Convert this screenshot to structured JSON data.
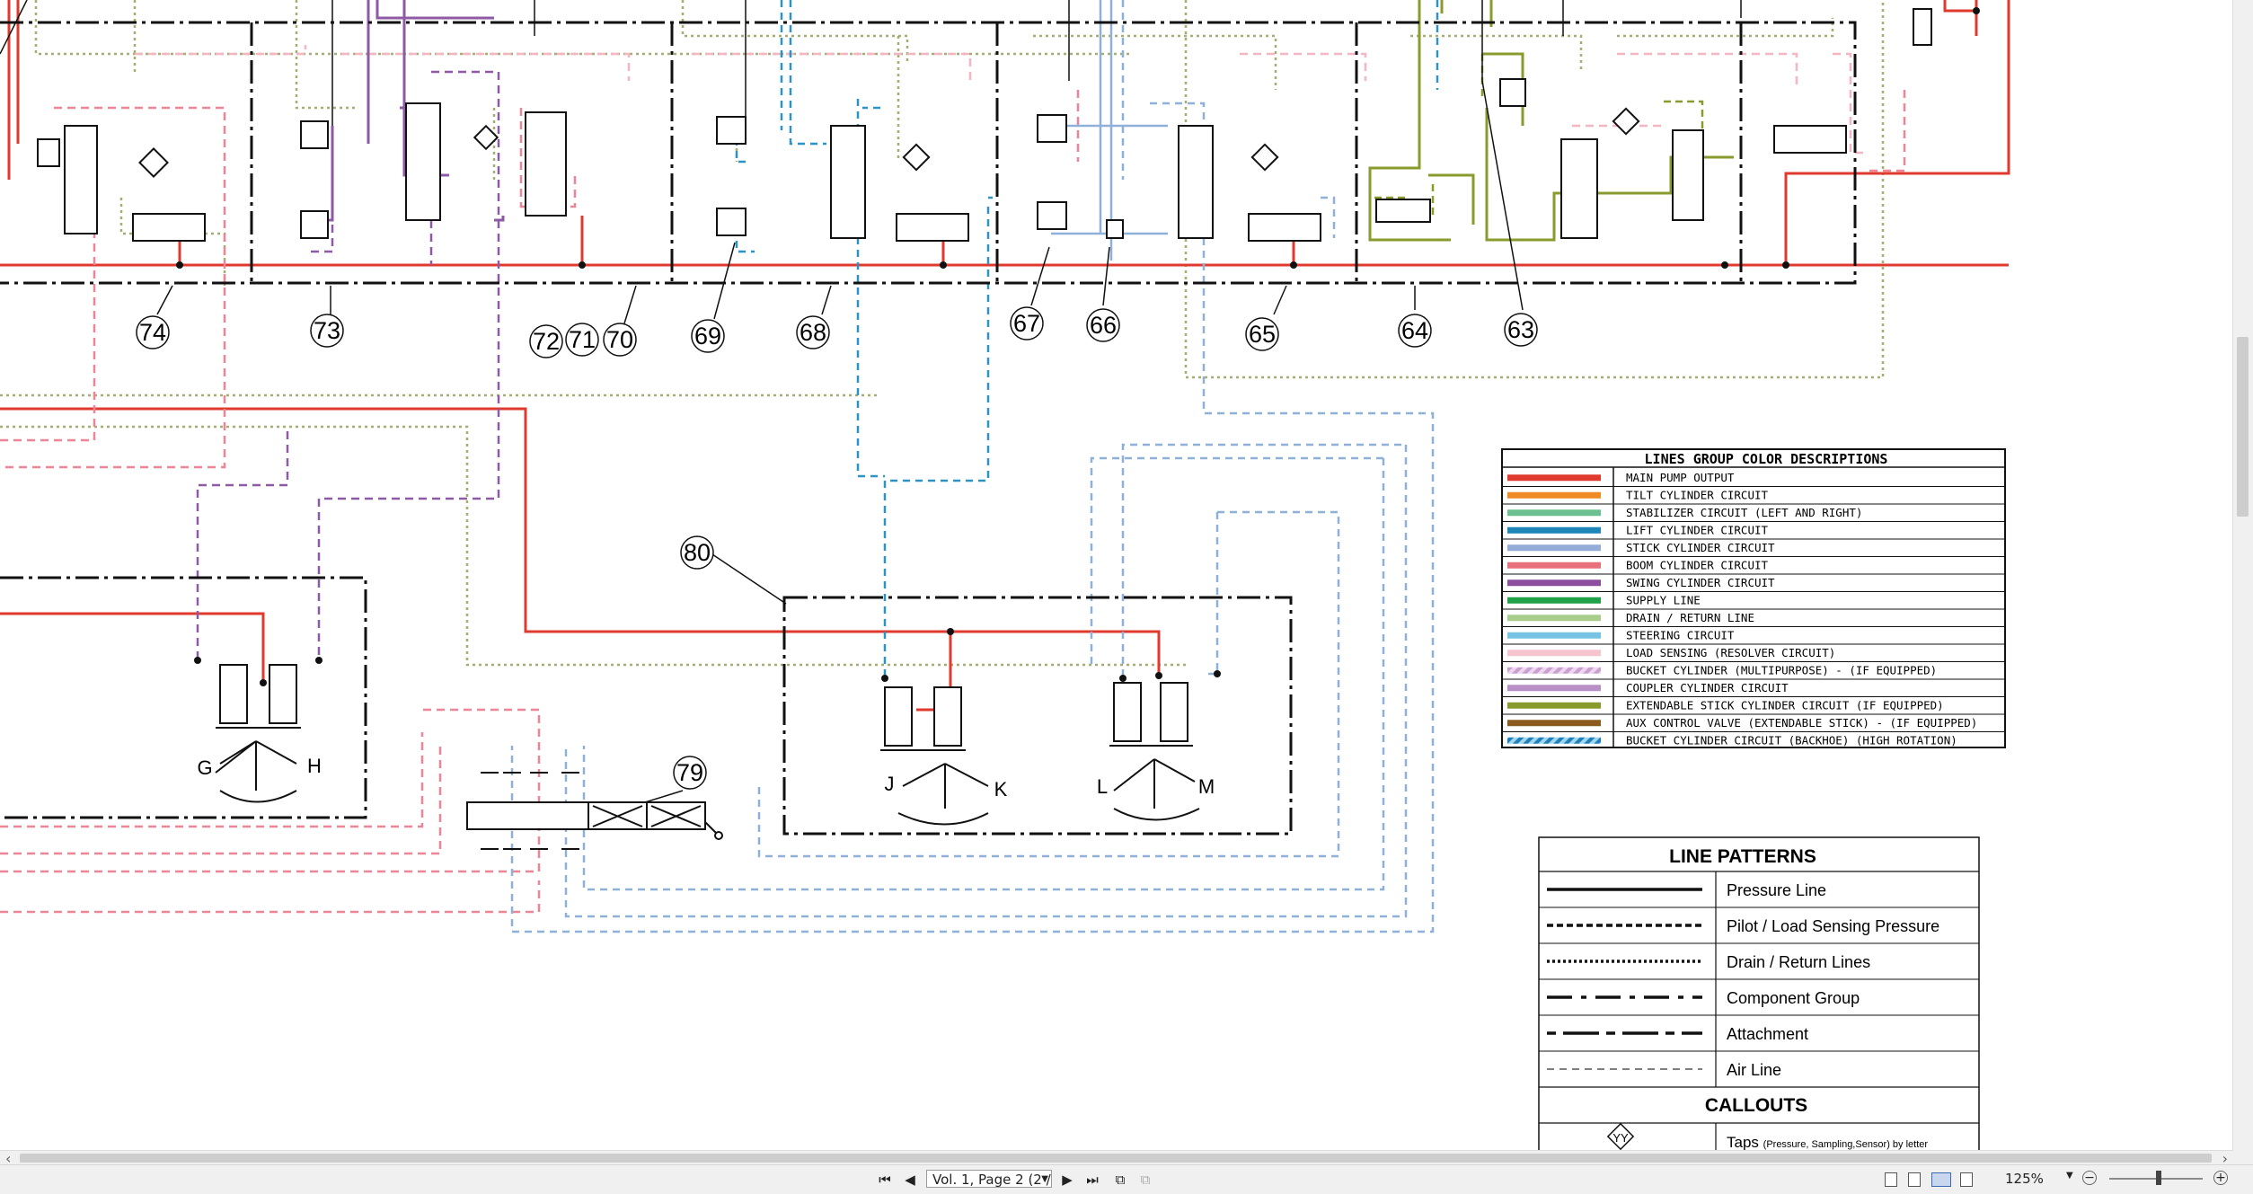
{
  "diagram": {
    "callouts": [
      "74",
      "73",
      "72",
      "71",
      "70",
      "69",
      "68",
      "67",
      "66",
      "65",
      "64",
      "63",
      "80",
      "79"
    ],
    "control_letters": [
      "G",
      "H",
      "J",
      "K",
      "L",
      "M"
    ]
  },
  "line_colors_legend": {
    "title": "LINES GROUP COLOR DESCRIPTIONS",
    "rows": [
      {
        "label": "MAIN PUMP OUTPUT",
        "color": "#e03a2e",
        "style": "solid"
      },
      {
        "label": "TILT CYLINDER CIRCUIT",
        "color": "#f08a24",
        "style": "solid"
      },
      {
        "label": "STABILIZER CIRCUIT (LEFT AND RIGHT)",
        "color": "#6cc08f",
        "style": "solid"
      },
      {
        "label": "LIFT CYLINDER CIRCUIT",
        "color": "#1e86b8",
        "style": "solid"
      },
      {
        "label": "STICK CYLINDER CIRCUIT",
        "color": "#93acd8",
        "style": "solid"
      },
      {
        "label": "BOOM CYLINDER CIRCUIT",
        "color": "#e8707c",
        "style": "solid"
      },
      {
        "label": "SWING CYLINDER CIRCUIT",
        "color": "#8b4f9e",
        "style": "solid"
      },
      {
        "label": "SUPPLY LINE",
        "color": "#1fa24a",
        "style": "solid"
      },
      {
        "label": "DRAIN / RETURN LINE",
        "color": "#a9cd8b",
        "style": "solid"
      },
      {
        "label": "STEERING CIRCUIT",
        "color": "#76c3e3",
        "style": "solid"
      },
      {
        "label": "LOAD SENSING (RESOLVER CIRCUIT)",
        "color": "#f6c4cc",
        "style": "solid"
      },
      {
        "label": "BUCKET CYLINDER (MULTIPURPOSE) - (IF EQUIPPED)",
        "color": "#d8b4dc",
        "style": "striped"
      },
      {
        "label": "COUPLER CYLINDER CIRCUIT",
        "color": "#b98fc7",
        "style": "solid"
      },
      {
        "label": "EXTENDABLE STICK CYLINDER CIRCUIT (IF EQUIPPED)",
        "color": "#8a9b2e",
        "style": "solid"
      },
      {
        "label": "AUX CONTROL VALVE (EXTENDABLE STICK) - (IF EQUIPPED)",
        "color": "#8a5a1e",
        "style": "solid"
      },
      {
        "label": "BUCKET CYLINDER CIRCUIT (BACKHOE) (HIGH ROTATION)",
        "color": "#2aa0d8",
        "style": "striped"
      }
    ]
  },
  "line_patterns_legend": {
    "title": "LINE PATTERNS",
    "rows": [
      {
        "label": "Pressure Line",
        "pattern": "solid"
      },
      {
        "label": "Pilot / Load Sensing Pressure",
        "pattern": "dashed"
      },
      {
        "label": "Drain / Return Lines",
        "pattern": "dotted"
      },
      {
        "label": "Component Group",
        "pattern": "dashdot"
      },
      {
        "label": "Attachment",
        "pattern": "longdash"
      },
      {
        "label": "Air Line",
        "pattern": "thin-dashed"
      }
    ],
    "callouts_title": "CALLOUTS",
    "callout_symbol": "YY",
    "taps_label": "Taps",
    "taps_note": "(Pressure, Sampling,Sensor) by letter"
  },
  "statusbar": {
    "page_value": "Vol. 1, Page 2 (2 /",
    "zoom": "125%",
    "icons": [
      "first-page-icon",
      "prev-page-icon",
      "next-page-icon",
      "last-page-icon",
      "prev-view-icon",
      "next-view-icon"
    ]
  }
}
